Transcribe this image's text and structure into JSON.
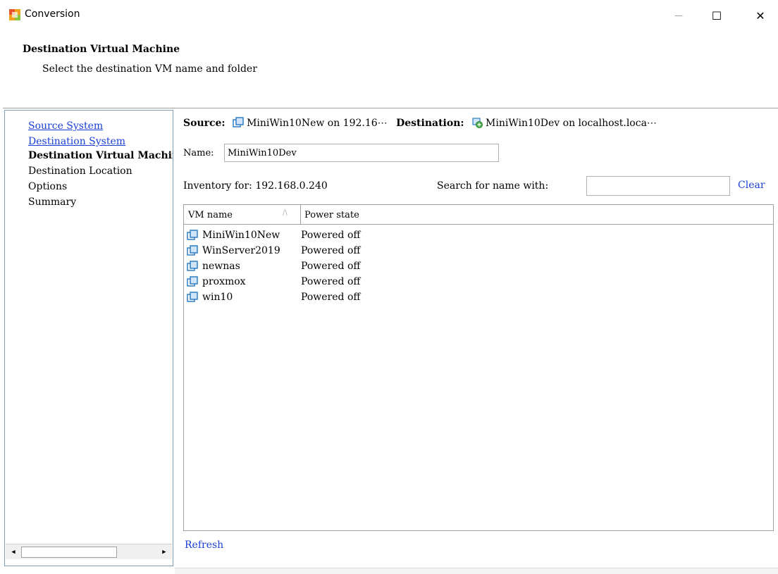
{
  "window": {
    "title": "Conversion",
    "minimize_glyph": "—",
    "maximize_glyph": "☐",
    "close_glyph": "✕"
  },
  "header": {
    "title": "Destination Virtual Machine",
    "subtitle": "Select the destination VM name and folder"
  },
  "nav": {
    "items": [
      {
        "label": "Source System",
        "state": "link"
      },
      {
        "label": "Destination System",
        "state": "link"
      },
      {
        "label": "Destination Virtual Machine",
        "state": "current"
      },
      {
        "label": "Destination Location",
        "state": "plain"
      },
      {
        "label": "Options",
        "state": "plain"
      },
      {
        "label": "Summary",
        "state": "plain"
      }
    ]
  },
  "summary": {
    "source_label": "Source:",
    "source_value": "MiniWin10New on 192.16⋯",
    "destination_label": "Destination:",
    "destination_value": "MiniWin10Dev on localhost.loca⋯"
  },
  "form": {
    "name_label": "Name:",
    "name_value": "MiniWin10Dev",
    "inventory_label": "Inventory for: 192.168.0.240",
    "search_label": "Search for name with:",
    "search_value": "",
    "clear_label": "Clear"
  },
  "vm_list": {
    "columns": [
      "VM name",
      "Power state"
    ],
    "sort_indicator": "/\\",
    "rows": [
      {
        "name": "MiniWin10New",
        "power": "Powered off"
      },
      {
        "name": "WinServer2019",
        "power": "Powered off"
      },
      {
        "name": "newnas",
        "power": "Powered off"
      },
      {
        "name": "proxmox",
        "power": "Powered off"
      },
      {
        "name": "win10",
        "power": "Powered off"
      }
    ]
  },
  "actions": {
    "refresh_label": "Refresh"
  },
  "scrollbar": {
    "left_arrow": "◀",
    "right_arrow": "▶"
  },
  "colors": {
    "link": "#1a3fd8",
    "vm_icon": "#2f7fc2",
    "border": "#a0a0a0"
  }
}
